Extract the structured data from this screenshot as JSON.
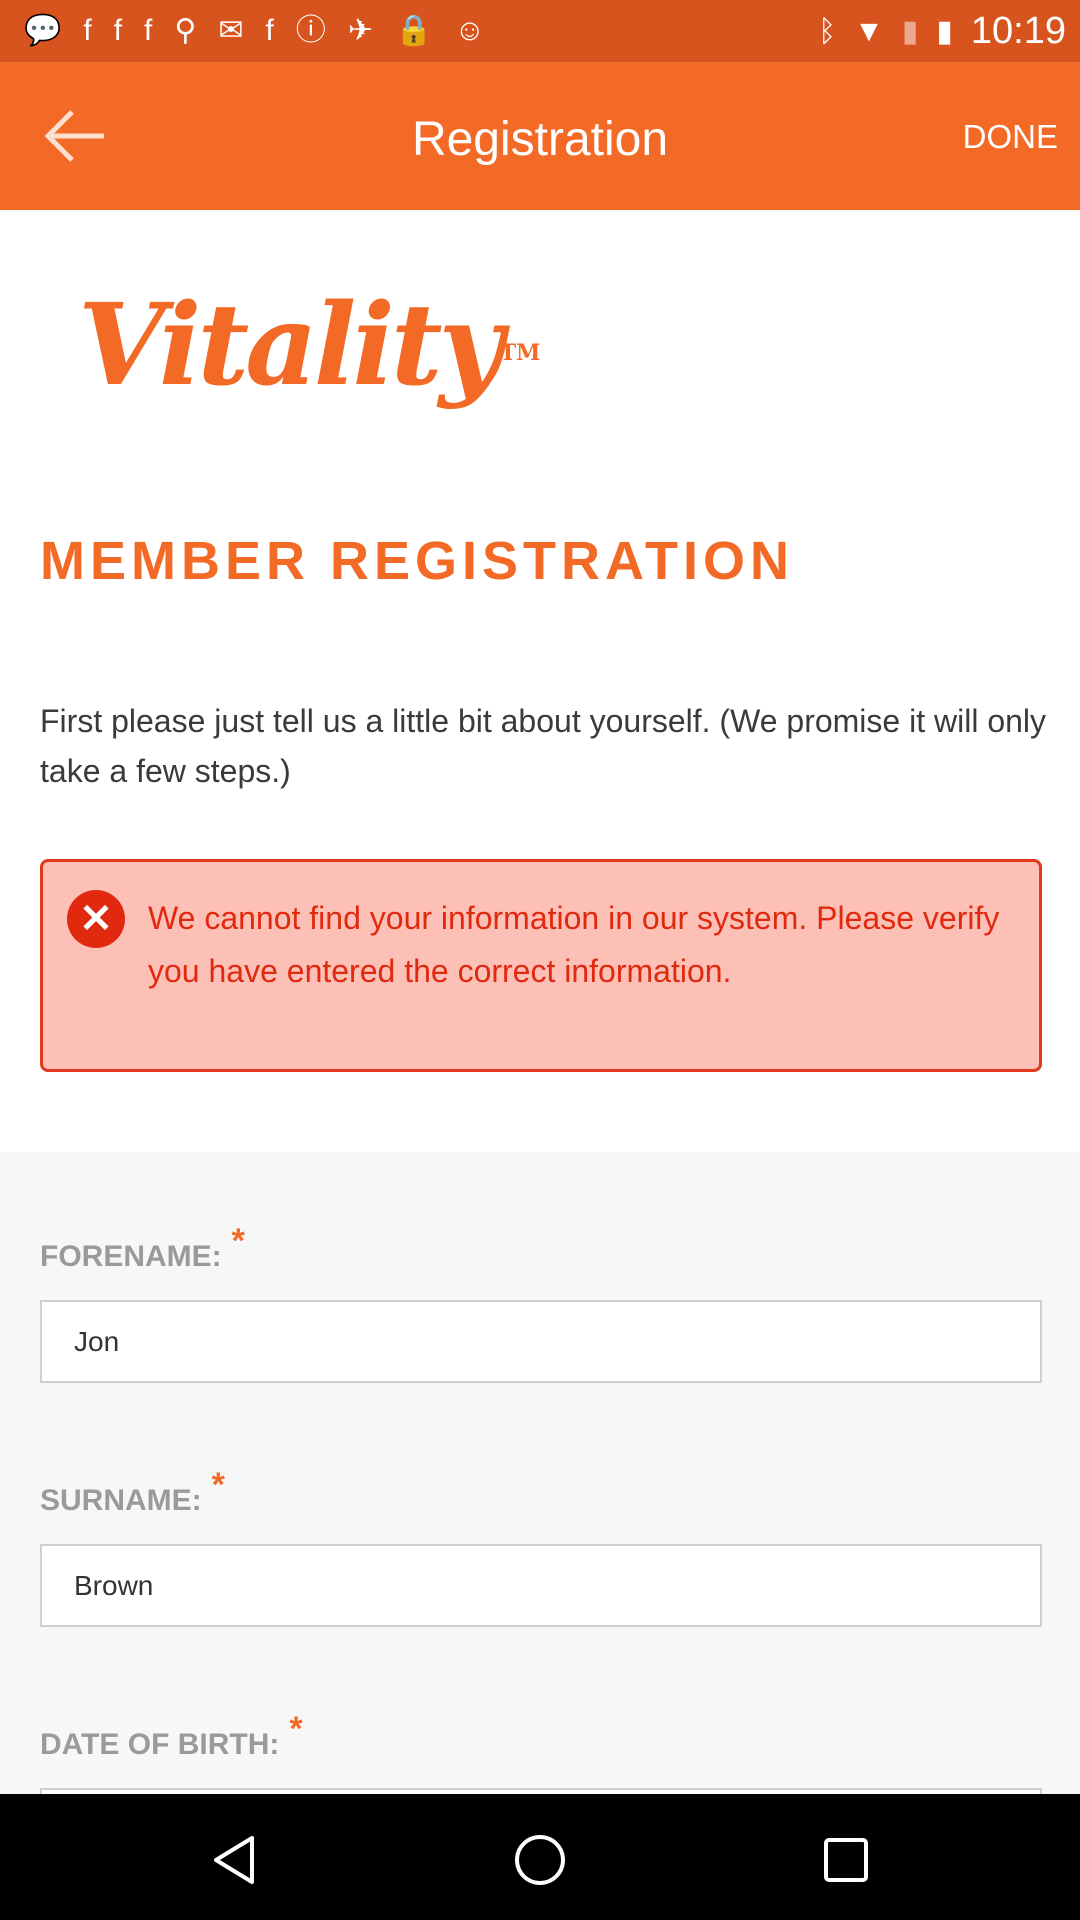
{
  "status_bar": {
    "time": "10:19",
    "notification_icons": [
      "chat-icon",
      "facebook-icon",
      "facebook-icon",
      "facebook-icon",
      "keyhole-icon",
      "mail-icon",
      "facebook-icon",
      "info-icon",
      "fake-gps-icon",
      "lock-icon",
      "android-icon"
    ],
    "system_icons": [
      "bluetooth-icon",
      "wifi-icon",
      "no-sim-icon",
      "battery-charging-icon"
    ]
  },
  "app_bar": {
    "title": "Registration",
    "done_label": "DONE"
  },
  "brand": {
    "logo_text": "Vitality",
    "trademark": "TM",
    "color": "#f26a25"
  },
  "main": {
    "heading": "MEMBER REGISTRATION",
    "intro": "First please just tell us a little bit about yourself. (We promise it will only take a few steps.)",
    "error_message": "We cannot find your information in our system. Please verify you have entered the correct information."
  },
  "form": {
    "required_mark": "*",
    "forename": {
      "label": "FORENAME:",
      "value": "Jon"
    },
    "surname": {
      "label": "SURNAME:",
      "value": "Brown"
    },
    "dob": {
      "label": "DATE OF BIRTH:",
      "value": ""
    }
  }
}
